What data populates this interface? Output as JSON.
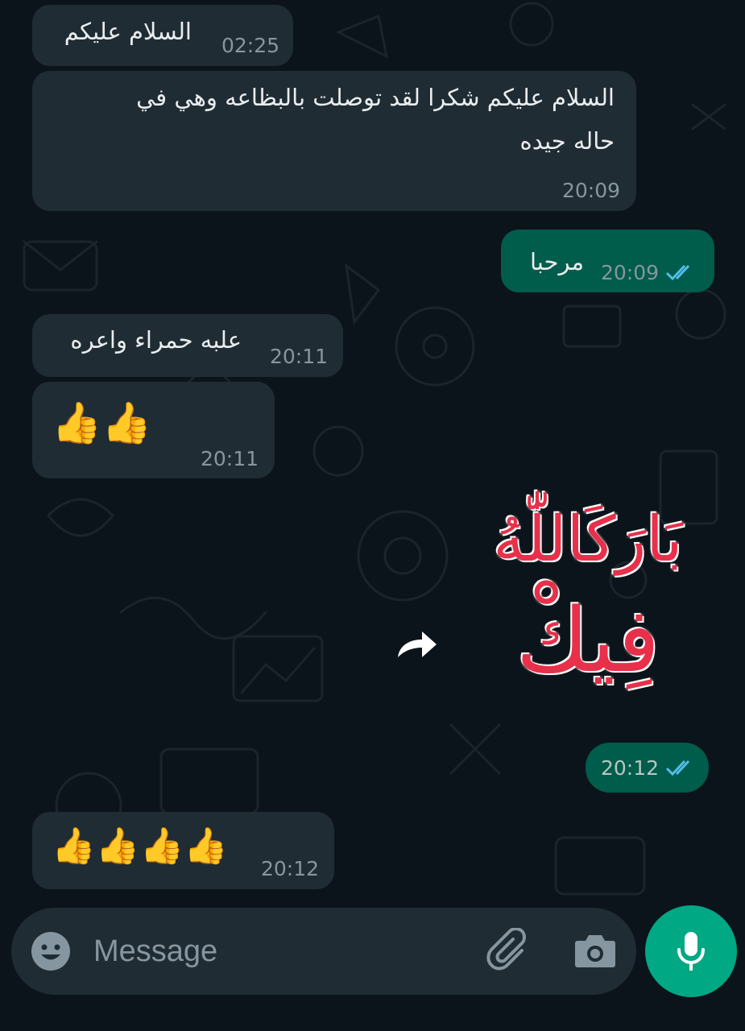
{
  "messages": [
    {
      "direction": "in",
      "text": "السلام عليكم",
      "time": "02:25"
    },
    {
      "direction": "in",
      "text_line1": "السلام عليكم شكرا لقد توصلت بالبظاعه وهي في",
      "text_line2": "حاله جيده",
      "time": "20:09"
    },
    {
      "direction": "out",
      "text": "مرحبا",
      "time": "20:09",
      "status": "read"
    },
    {
      "direction": "in",
      "text": "علبه حمراء واعره",
      "time": "20:11"
    },
    {
      "direction": "in",
      "emoji": "👍👍",
      "time": "20:11"
    },
    {
      "direction": "out",
      "sticker_text_line1": "بَارَكَاللّٰهُ",
      "sticker_text_line2": "فِيكْ",
      "time": "20:12",
      "status": "read"
    },
    {
      "direction": "in",
      "emoji": "👍👍👍👍",
      "time": "20:12"
    }
  ],
  "composer": {
    "placeholder": "Message",
    "icons": [
      "emoji-icon",
      "attach-icon",
      "camera-icon",
      "mic-icon"
    ]
  },
  "colors": {
    "background": "#0b141a",
    "incoming_bubble": "#202c33",
    "outgoing_bubble": "#005c4b",
    "accent": "#00a884",
    "read_ticks": "#53bdeb",
    "sticker_red": "#e8304a"
  }
}
